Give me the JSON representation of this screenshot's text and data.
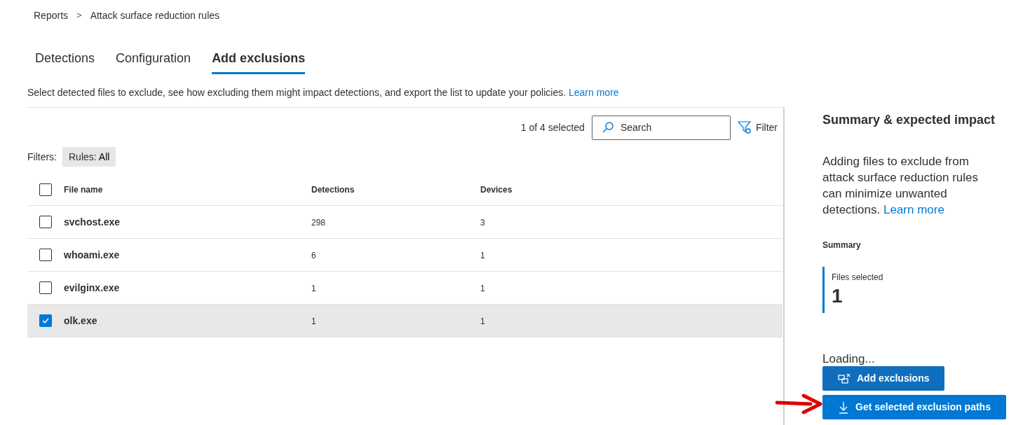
{
  "breadcrumb": [
    "Reports",
    "Attack surface reduction rules"
  ],
  "breadcrumb_separator": ">",
  "tabs": [
    {
      "label": "Detections",
      "selected": false
    },
    {
      "label": "Configuration",
      "selected": false
    },
    {
      "label": "Add exclusions",
      "selected": true
    }
  ],
  "description": {
    "text": "Select detected files to exclude, see how excluding them might impact detections, and export the list to update your policies.",
    "link": "Learn more"
  },
  "toolbar": {
    "selection_count": "1 of 4 selected",
    "search": {
      "placeholder": "Search"
    },
    "filter_button": "Filter"
  },
  "filters": {
    "label": "Filters:",
    "chips": [
      {
        "name": "Rules:",
        "value": "All"
      }
    ]
  },
  "table": {
    "select_all_checked": false,
    "columns": [
      "File name",
      "Detections",
      "Devices"
    ],
    "rows": [
      {
        "file_name": "svchost.exe",
        "detections": "298",
        "devices": "3",
        "selected": false
      },
      {
        "file_name": "whoami.exe",
        "detections": "6",
        "devices": "1",
        "selected": false
      },
      {
        "file_name": "evilginx.exe",
        "detections": "1",
        "devices": "1",
        "selected": false
      },
      {
        "file_name": "olk.exe",
        "detections": "1",
        "devices": "1",
        "selected": true
      }
    ]
  },
  "side_panel": {
    "title": "Summary & expected impact",
    "text": "Adding files to exclude from attack surface reduction rules can minimize unwanted detections.",
    "link": "Learn more",
    "summary_heading": "Summary",
    "metric": {
      "label": "Files selected",
      "value": "1"
    },
    "status": "Loading...",
    "buttons": [
      "Add exclusions",
      "Get selected exclusion paths"
    ]
  }
}
